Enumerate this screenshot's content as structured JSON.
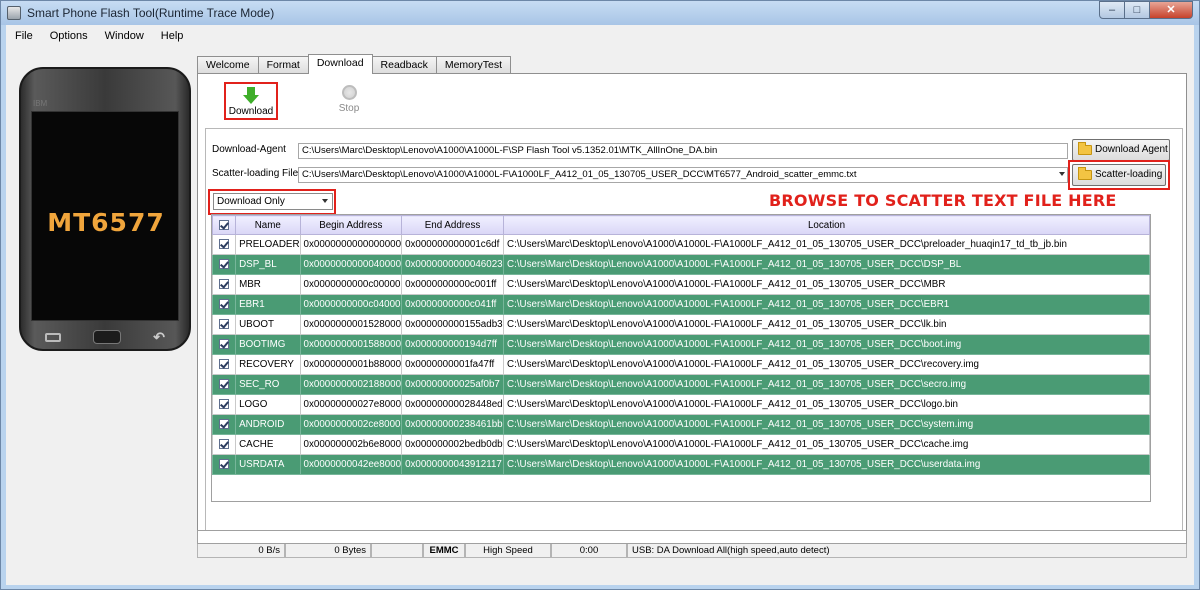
{
  "window": {
    "title": "Smart Phone Flash Tool(Runtime Trace Mode)",
    "min": "–",
    "max": "□",
    "close": "✕"
  },
  "menu": [
    "File",
    "Options",
    "Window",
    "Help"
  ],
  "phone": {
    "brand": "IBM",
    "model": "MT6577"
  },
  "tabs": [
    "Welcome",
    "Format",
    "Download",
    "Readback",
    "MemoryTest"
  ],
  "toolbar": {
    "download": "Download",
    "stop": "Stop"
  },
  "form": {
    "agent_label": "Download-Agent",
    "agent_path": "C:\\Users\\Marc\\Desktop\\Lenovo\\A1000\\A1000L-F\\SP Flash Tool v5.1352.01\\MTK_AllInOne_DA.bin",
    "agent_button": "Download Agent",
    "scatter_label": "Scatter-loading File",
    "scatter_path": "C:\\Users\\Marc\\Desktop\\Lenovo\\A1000\\A1000L-F\\A1000LF_A412_01_05_130705_USER_DCC\\MT6577_Android_scatter_emmc.txt",
    "scatter_button": "Scatter-loading",
    "mode": "Download Only"
  },
  "annotation": "BROWSE TO SCATTER TEXT FILE HERE",
  "table": {
    "headers": [
      "",
      "Name",
      "Begin Address",
      "End Address",
      "Location"
    ],
    "rows": [
      {
        "name": "PRELOADER",
        "begin": "0x0000000000000000",
        "end": "0x000000000001c6df",
        "location": "C:\\Users\\Marc\\Desktop\\Lenovo\\A1000\\A1000L-F\\A1000LF_A412_01_05_130705_USER_DCC\\preloader_huaqin17_td_tb_jb.bin"
      },
      {
        "name": "DSP_BL",
        "begin": "0x0000000000040000",
        "end": "0x0000000000046023",
        "location": "C:\\Users\\Marc\\Desktop\\Lenovo\\A1000\\A1000L-F\\A1000LF_A412_01_05_130705_USER_DCC\\DSP_BL"
      },
      {
        "name": "MBR",
        "begin": "0x0000000000c00000",
        "end": "0x0000000000c001ff",
        "location": "C:\\Users\\Marc\\Desktop\\Lenovo\\A1000\\A1000L-F\\A1000LF_A412_01_05_130705_USER_DCC\\MBR"
      },
      {
        "name": "EBR1",
        "begin": "0x0000000000c04000",
        "end": "0x0000000000c041ff",
        "location": "C:\\Users\\Marc\\Desktop\\Lenovo\\A1000\\A1000L-F\\A1000LF_A412_01_05_130705_USER_DCC\\EBR1"
      },
      {
        "name": "UBOOT",
        "begin": "0x0000000001528000",
        "end": "0x000000000155adb3",
        "location": "C:\\Users\\Marc\\Desktop\\Lenovo\\A1000\\A1000L-F\\A1000LF_A412_01_05_130705_USER_DCC\\lk.bin"
      },
      {
        "name": "BOOTIMG",
        "begin": "0x0000000001588000",
        "end": "0x000000000194d7ff",
        "location": "C:\\Users\\Marc\\Desktop\\Lenovo\\A1000\\A1000L-F\\A1000LF_A412_01_05_130705_USER_DCC\\boot.img"
      },
      {
        "name": "RECOVERY",
        "begin": "0x0000000001b88000",
        "end": "0x0000000001fa47ff",
        "location": "C:\\Users\\Marc\\Desktop\\Lenovo\\A1000\\A1000L-F\\A1000LF_A412_01_05_130705_USER_DCC\\recovery.img"
      },
      {
        "name": "SEC_RO",
        "begin": "0x0000000002188000",
        "end": "0x00000000025af0b7",
        "location": "C:\\Users\\Marc\\Desktop\\Lenovo\\A1000\\A1000L-F\\A1000LF_A412_01_05_130705_USER_DCC\\secro.img"
      },
      {
        "name": "LOGO",
        "begin": "0x00000000027e8000",
        "end": "0x00000000028448ed",
        "location": "C:\\Users\\Marc\\Desktop\\Lenovo\\A1000\\A1000L-F\\A1000LF_A412_01_05_130705_USER_DCC\\logo.bin"
      },
      {
        "name": "ANDROID",
        "begin": "0x0000000002ce8000",
        "end": "0x00000000238461bb",
        "location": "C:\\Users\\Marc\\Desktop\\Lenovo\\A1000\\A1000L-F\\A1000LF_A412_01_05_130705_USER_DCC\\system.img"
      },
      {
        "name": "CACHE",
        "begin": "0x000000002b6e8000",
        "end": "0x000000002bedb0db",
        "location": "C:\\Users\\Marc\\Desktop\\Lenovo\\A1000\\A1000L-F\\A1000LF_A412_01_05_130705_USER_DCC\\cache.img"
      },
      {
        "name": "USRDATA",
        "begin": "0x0000000042ee8000",
        "end": "0x0000000043912117",
        "location": "C:\\Users\\Marc\\Desktop\\Lenovo\\A1000\\A1000L-F\\A1000LF_A412_01_05_130705_USER_DCC\\userdata.img"
      }
    ]
  },
  "status": {
    "speed": "0 B/s",
    "bytes": "0 Bytes",
    "storage": "EMMC",
    "usb_speed": "High Speed",
    "time": "0:00",
    "message": "USB: DA Download All(high speed,auto detect)"
  }
}
